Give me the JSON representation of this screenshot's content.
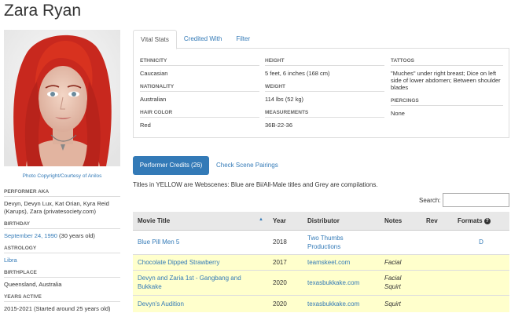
{
  "performer_name": "Zara Ryan",
  "photo_credit": "Photo Copyright/Courtesy of Anilos",
  "bio": [
    {
      "label": "PERFORMER AKA",
      "value": "Devyn, Devyn Lux, Kat Orian, Kyra Reid (Karups), Zara (privatesociety.com)"
    },
    {
      "label": "BIRTHDAY",
      "value_link": "September 24, 1990",
      "value_rest": " (30 years old)"
    },
    {
      "label": "ASTROLOGY",
      "value_link": "Libra"
    },
    {
      "label": "BIRTHPLACE",
      "value": "Queensland, Australia"
    },
    {
      "label": "YEARS ACTIVE",
      "value": "2015-2021 (Started around 25 years old)"
    }
  ],
  "tabs": [
    "Vital Stats",
    "Credited With",
    "Filter"
  ],
  "vital_stats": {
    "ethnicity_label": "ETHNICITY",
    "ethnicity": "Caucasian",
    "nationality_label": "NATIONALITY",
    "nationality": "Australian",
    "hair_label": "HAIR COLOR",
    "hair": "Red",
    "height_label": "HEIGHT",
    "height": "5 feet, 6 inches (168 cm)",
    "weight_label": "WEIGHT",
    "weight": "114 lbs (52 kg)",
    "measurements_label": "MEASUREMENTS",
    "measurements": "36B-22-36",
    "tattoos_label": "TATTOOS",
    "tattoos": "\"Muches\" under right breast; Dice on left side of lower abdomen; Between shoulder blades",
    "piercings_label": "PIERCINGS",
    "piercings": "None"
  },
  "credits": {
    "button": "Performer Credits (26)",
    "pairings_link": "Check Scene Pairings",
    "note": "Titles in YELLOW are Webscenes: Blue are Bi/All-Male titles and Grey are compilations.",
    "search_label": "Search:",
    "search_value": "",
    "columns": [
      "Movie Title",
      "Year",
      "Distributor",
      "Notes",
      "Rev",
      "Formats"
    ],
    "rows": [
      {
        "title": "Blue Pill Men 5",
        "year": "2018",
        "distributor": "Two Thumbs Productions",
        "notes": "",
        "rev": "",
        "formats": "D",
        "style": "white"
      },
      {
        "title": "Chocolate Dipped Strawberry",
        "year": "2017",
        "distributor": "teamskeet.com",
        "notes": "Facial",
        "rev": "",
        "formats": "",
        "style": "yellow"
      },
      {
        "title": "Devyn and Zaria 1st - Gangbang and Bukkake",
        "year": "2020",
        "distributor": "texasbukkake.com",
        "notes": "Facial\nSquirt",
        "rev": "",
        "formats": "",
        "style": "yellow"
      },
      {
        "title": "Devyn's Audition",
        "year": "2020",
        "distributor": "texasbukkake.com",
        "notes": "Squirt",
        "rev": "",
        "formats": "",
        "style": "yellow"
      }
    ]
  },
  "colors": {
    "link": "#337ab7",
    "webscene_row": "#ffffcc",
    "button": "#337ab7",
    "header_bg": "#e8e8e8"
  },
  "icons": {
    "sort": "sort-up-icon",
    "help": "question-circle-icon"
  }
}
